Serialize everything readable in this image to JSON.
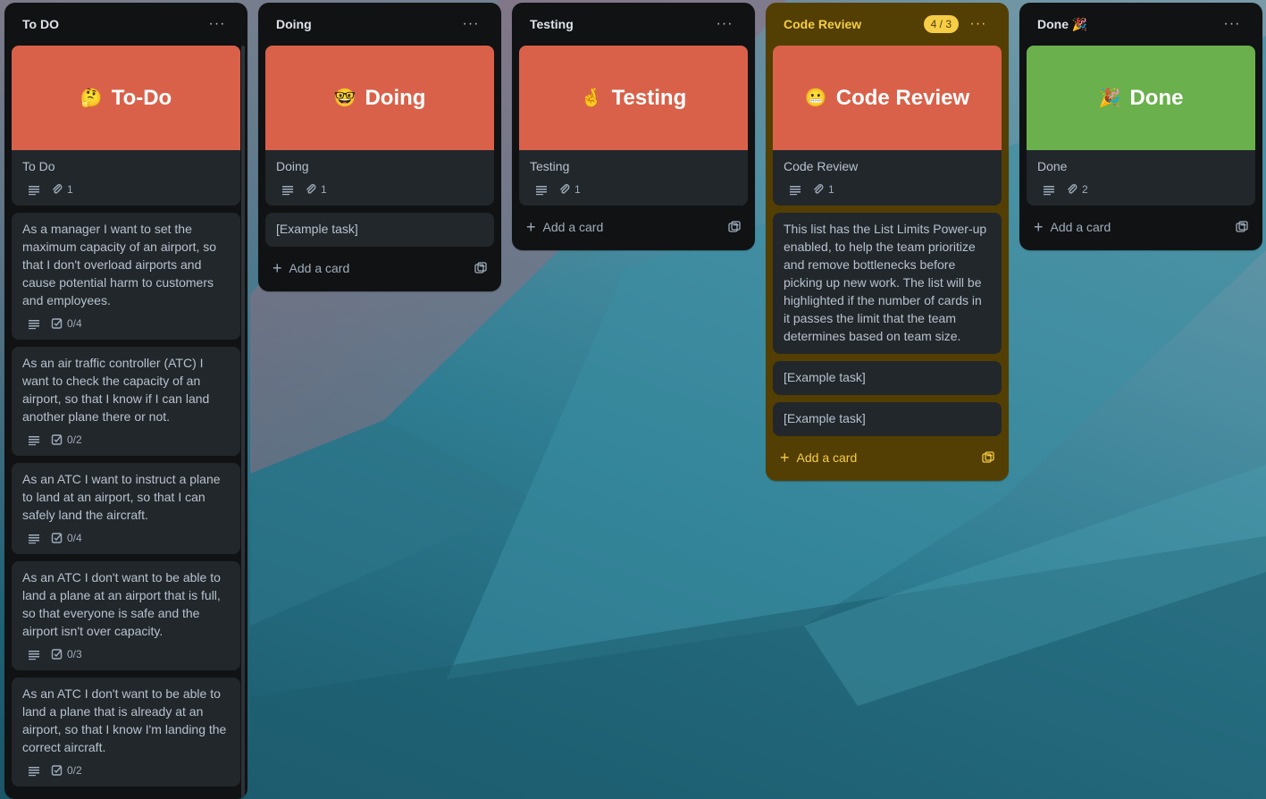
{
  "lists": [
    {
      "title": "To DO",
      "menu": "···",
      "cards": [
        {
          "cover": {
            "emoji": "🤔",
            "text": "To-Do",
            "color": "#d9614a"
          },
          "title": "To Do",
          "description": true,
          "attachments": "1"
        },
        {
          "title": "As a manager I want to set the maximum capacity of an airport, so that I don't overload airports and cause potential harm to customers and employees.",
          "description": true,
          "checklist": "0/4"
        },
        {
          "title": "As an air traffic controller (ATC) I want to check the capacity of an airport, so that I know if I can land another plane there or not.",
          "description": true,
          "checklist": "0/2"
        },
        {
          "title": "As an ATC I want to instruct a plane to land at an airport, so that I can safely land the aircraft.",
          "description": true,
          "checklist": "0/4"
        },
        {
          "title": "As an ATC I don't want to be able to land a plane at an airport that is full, so that everyone is safe and the airport isn't over capacity.",
          "description": true,
          "checklist": "0/3"
        },
        {
          "title": "As an ATC I don't want to be able to land a plane that is already at an airport, so that I know I'm landing the correct aircraft.",
          "description": true,
          "checklist": "0/2"
        }
      ]
    },
    {
      "title": "Doing",
      "menu": "···",
      "cards": [
        {
          "cover": {
            "emoji": "🤓",
            "text": "Doing",
            "color": "#d9614a"
          },
          "title": "Doing",
          "description": true,
          "attachments": "1"
        },
        {
          "title": "[Example task]"
        }
      ],
      "add_card": "Add a card"
    },
    {
      "title": "Testing",
      "menu": "···",
      "cards": [
        {
          "cover": {
            "emoji": "🤞",
            "text": "Testing",
            "color": "#d9614a"
          },
          "title": "Testing",
          "description": true,
          "attachments": "1"
        }
      ],
      "add_card": "Add a card"
    },
    {
      "title": "Code Review",
      "menu": "···",
      "highlight": true,
      "limit_badge": "4 / 3",
      "cards": [
        {
          "cover": {
            "emoji": "😬",
            "text": "Code Review",
            "color": "#d9614a"
          },
          "title": "Code Review",
          "description": true,
          "attachments": "1"
        },
        {
          "title": "This list has the List Limits Power-up enabled, to help the team prioritize and remove bottlenecks before picking up new work. The list will be highlighted if the number of cards in it passes the limit that the team determines based on team size."
        },
        {
          "title": "[Example task]"
        },
        {
          "title": "[Example task]"
        }
      ],
      "add_card": "Add a card"
    },
    {
      "title": "Done 🎉",
      "menu": "···",
      "cards": [
        {
          "cover": {
            "emoji": "🎉",
            "text": "Done",
            "color": "#6ab04c"
          },
          "title": "Done",
          "description": true,
          "attachments": "2"
        }
      ],
      "add_card": "Add a card"
    }
  ]
}
